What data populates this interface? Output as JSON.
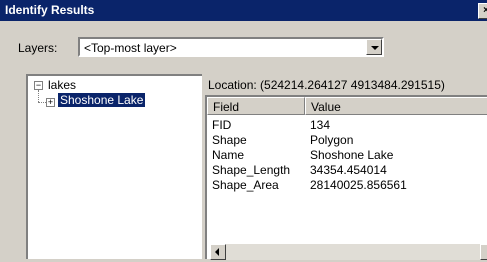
{
  "window": {
    "title": "Identify Results"
  },
  "layers": {
    "label": "Layers:",
    "selected": "<Top-most layer>"
  },
  "tree": {
    "root": {
      "expander": "−",
      "label": "lakes"
    },
    "child": {
      "expander": "+",
      "label": "Shoshone Lake"
    }
  },
  "location": {
    "text": "Location: (524214.264127 4913484.291515)"
  },
  "table": {
    "headers": {
      "field": "Field",
      "value": "Value"
    },
    "rows": [
      {
        "field": "FID",
        "value": "134"
      },
      {
        "field": "Shape",
        "value": "Polygon"
      },
      {
        "field": "Name",
        "value": "Shoshone Lake"
      },
      {
        "field": "Shape_Length",
        "value": "34354.454014"
      },
      {
        "field": "Shape_Area",
        "value": "28140025.856561"
      }
    ]
  }
}
